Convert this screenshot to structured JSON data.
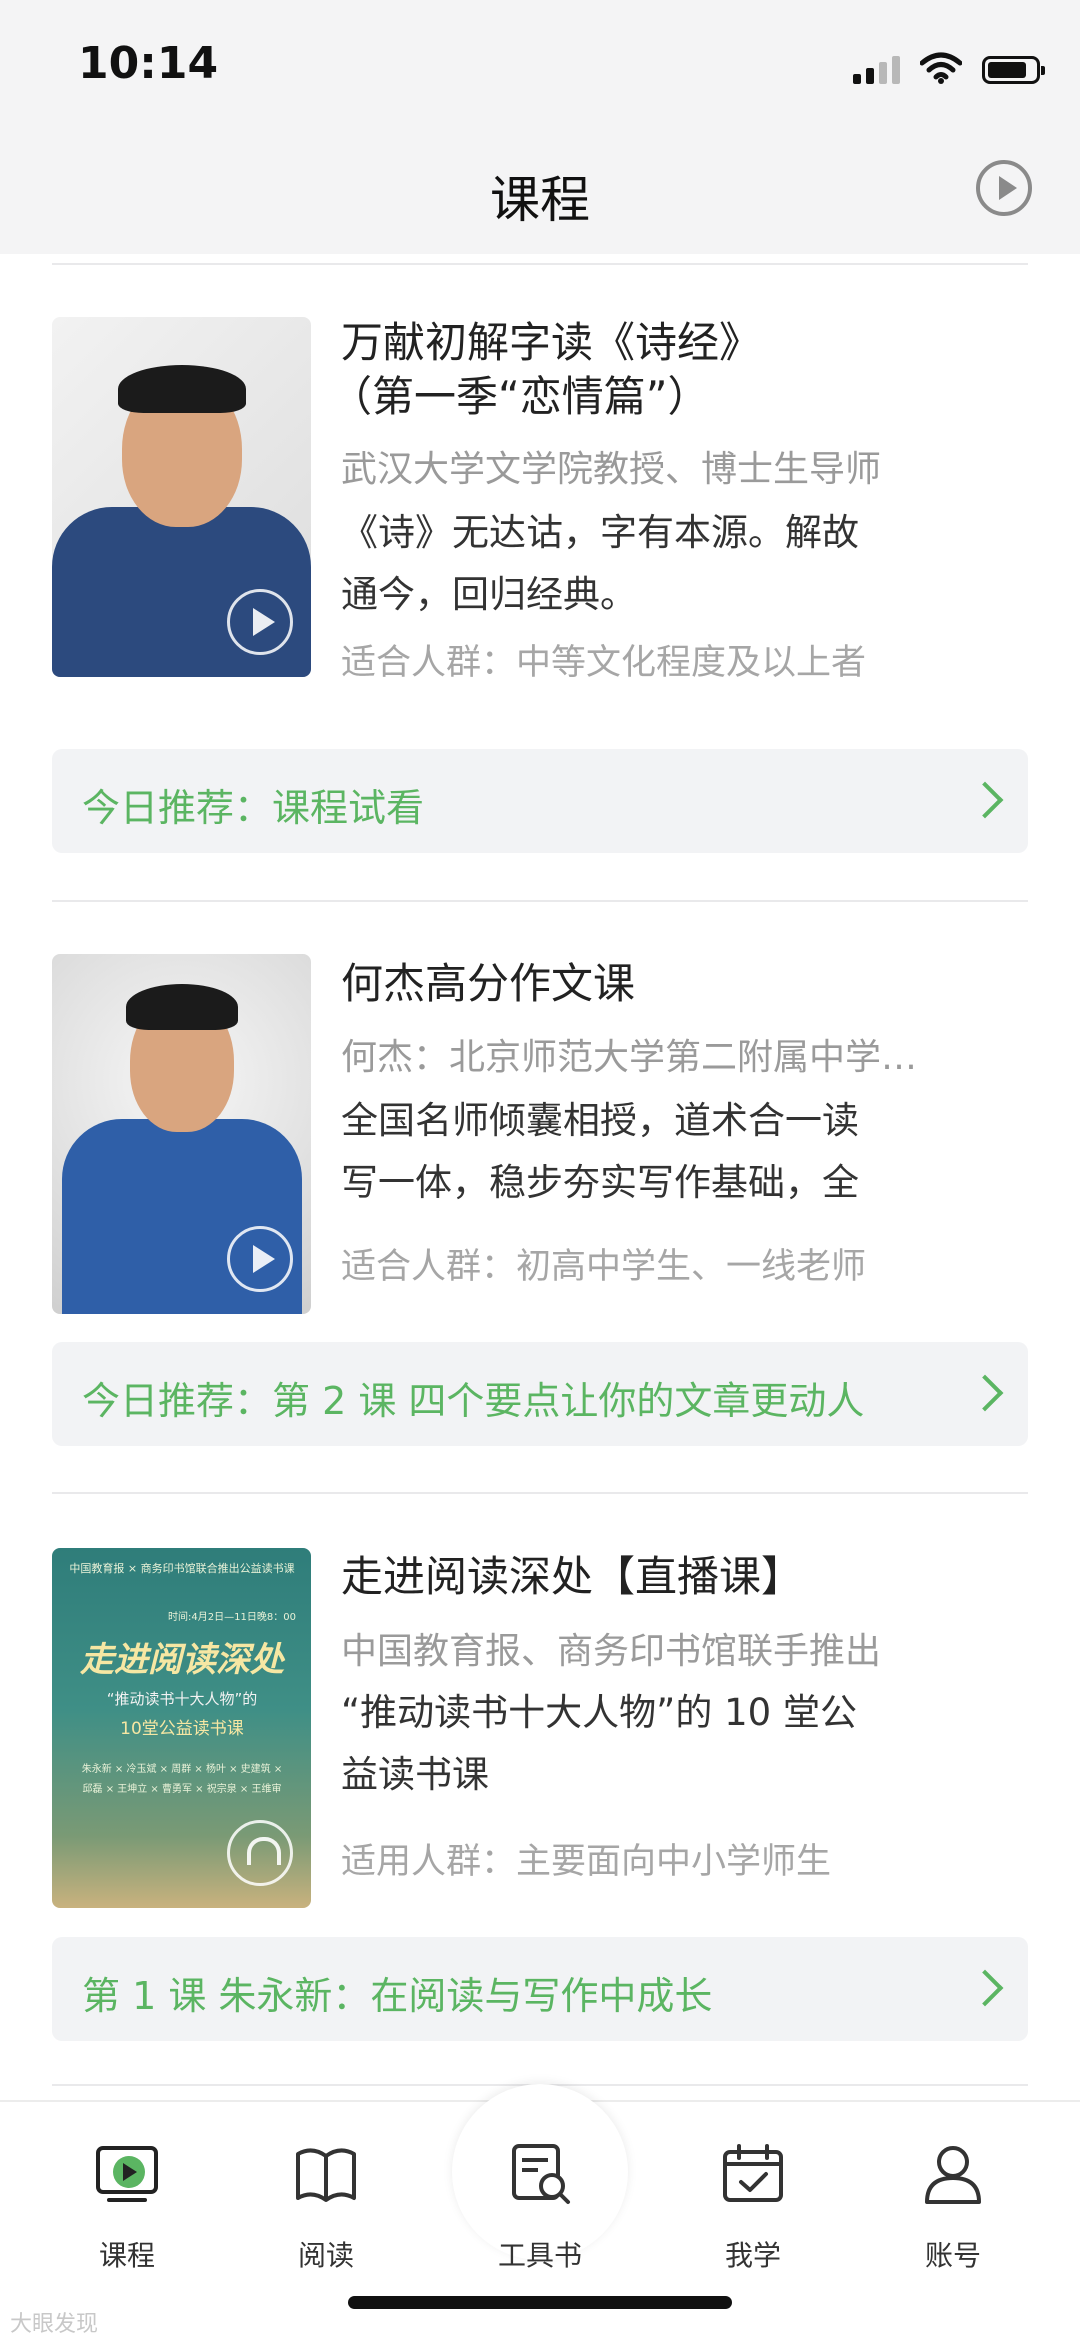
{
  "status_bar": {
    "time": "10:14"
  },
  "header": {
    "title": "课程",
    "play_icon": "play-circle-icon"
  },
  "courses": [
    {
      "title_line1": "万献初解字读《诗经》",
      "title_line2": "（第一季“恋情篇”）",
      "subtitle": "武汉大学文学院教授、博士生导师",
      "desc_line1": "《诗》无达诂，字有本源。解故",
      "desc_line2": "通今，回归经典。",
      "audience": "适合人群：中等文化程度及以上者",
      "media_icon": "play-icon",
      "recommend": "今日推荐：课程试看"
    },
    {
      "title_line1": "何杰高分作文课",
      "subtitle": "何杰：北京师范大学第二附属中学语文特级教师",
      "desc_line1": "全国名师倾囊相授，道术合一读",
      "desc_line2": "写一体，稳步夯实写作基础，全",
      "audience": "适合人群：初高中学生、一线老师",
      "media_icon": "play-icon",
      "recommend": "今日推荐：第 2 课 四个要点让你的文章更动人"
    },
    {
      "title_line1": "走进阅读深处【直播课】",
      "subtitle": "中国教育报、商务印书馆联手推出",
      "desc_line1": "“推动读书十大人物”的 10 堂公",
      "desc_line2": "益读书课",
      "audience": "适用人群：主要面向中小学师生",
      "media_icon": "headphones-icon",
      "recommend": "第 1 课 朱永新：在阅读与写作中成长",
      "cover": {
        "top": "中国教育报 × 商务印书馆联合推出公益读书课",
        "time": "时间:4月2日—11日晚8：00",
        "title": "走进阅读深处",
        "sub1": "“推动读书十大人物”的",
        "sub2": "10堂公益读书课",
        "names1": "朱永新 × 冷玉斌 × 周群 × 杨叶 × 史建筑 ×",
        "names2": "邱磊 × 王坤立 × 曹勇军 × 祝宗泉 × 王维审"
      }
    }
  ],
  "nav": [
    {
      "label": "课程",
      "icon": "course-tv-icon",
      "active": true
    },
    {
      "label": "阅读",
      "icon": "book-open-icon"
    },
    {
      "label": "工具书",
      "icon": "dictionary-search-icon"
    },
    {
      "label": "我学",
      "icon": "calendar-check-icon"
    },
    {
      "label": "账号",
      "icon": "user-icon"
    }
  ],
  "colors": {
    "accent": "#5bb562",
    "background": "#f4f4f5"
  },
  "watermark": "大眼发现"
}
